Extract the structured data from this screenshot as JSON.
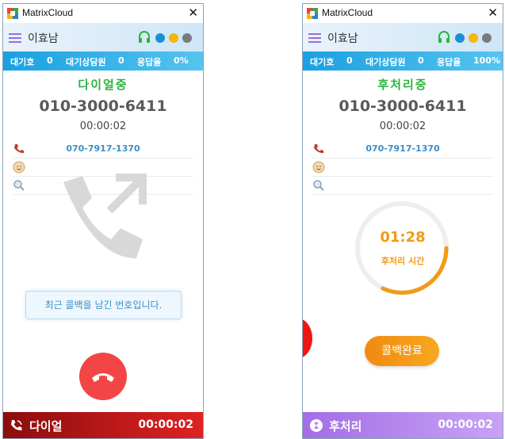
{
  "app_title": "MatrixCloud",
  "left": {
    "user_name": "이효남",
    "stats": {
      "waiting_label": "대기호",
      "waiting": "0",
      "agents_label": "대기상담원",
      "agents": "0",
      "rate_label": "응답율",
      "rate": "0%"
    },
    "status_title": "다이얼중",
    "phone_number": "010-3000-6411",
    "call_timer": "00:00:02",
    "callback_number": "070-7917-1370",
    "notice": "최근 콜백을 남긴 번호입니다.",
    "footer": {
      "state": "다이얼",
      "timer": "00:00:02"
    }
  },
  "right": {
    "user_name": "이효남",
    "stats": {
      "waiting_label": "대기호",
      "waiting": "0",
      "agents_label": "대기상담원",
      "agents": "0",
      "rate_label": "응답율",
      "rate": "100%"
    },
    "status_title": "후처리중",
    "phone_number": "010-3000-6411",
    "call_timer": "00:00:02",
    "callback_number": "070-7917-1370",
    "wrapup_time": "01:28",
    "wrapup_label": "후처리 시간",
    "complete_button": "콜백완료",
    "footer": {
      "state": "후처리",
      "timer": "00:00:02"
    }
  },
  "colors": {
    "online": "#1a8fd6",
    "away": "#f5b800",
    "offline": "#7a7a7a",
    "headset": "#2db340",
    "dial_green": "#2db340",
    "wrapup_orange": "#f39a14",
    "hangup_red": "#f34545"
  },
  "icons": [
    "app-logo",
    "menu-icon",
    "headset-icon",
    "phone-icon",
    "face-icon",
    "search-icon",
    "hangup-icon",
    "wrapup-icon"
  ]
}
